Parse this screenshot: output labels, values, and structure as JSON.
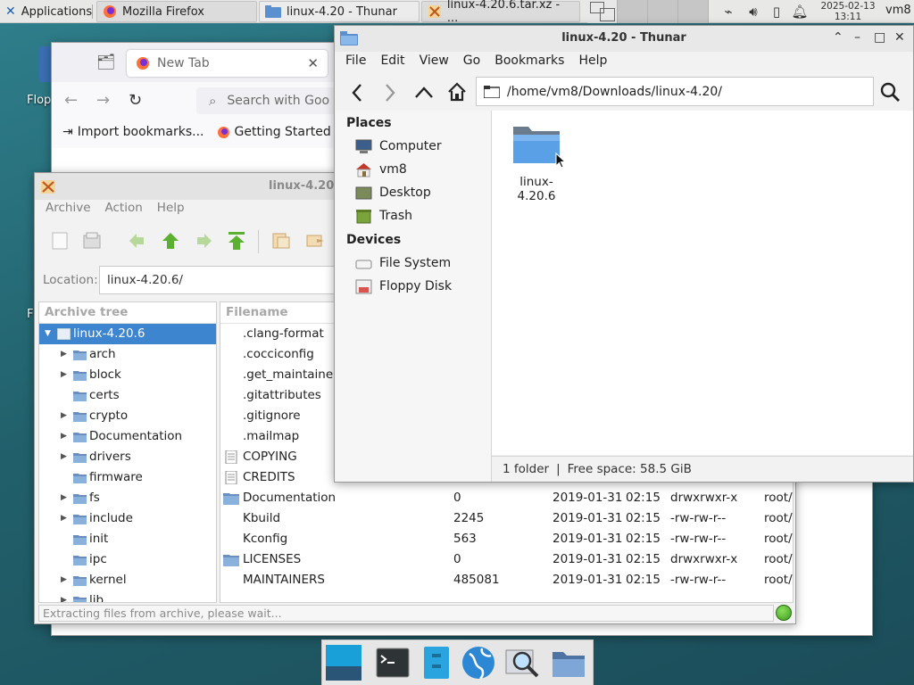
{
  "panel": {
    "applications_label": "Applications",
    "tasks": [
      {
        "label": "Mozilla Firefox"
      },
      {
        "label": "linux-4.20 - Thunar"
      },
      {
        "label": "linux-4.20.6.tar.xz - ..."
      }
    ],
    "clock_date": "2025-02-13",
    "clock_time": "13:11",
    "user": "vm8"
  },
  "desktop": {
    "icon_label_1": "Flop",
    "icon_label_2": "F"
  },
  "firefox": {
    "tab_title": "New Tab",
    "search_placeholder": "Search with Goo",
    "bookmarks": [
      {
        "label": "Import bookmarks..."
      },
      {
        "label": "Getting Started"
      }
    ]
  },
  "xarchiver": {
    "title": "linux-4.20.",
    "menu": [
      "Archive",
      "Action",
      "Help"
    ],
    "location_label": "Location:",
    "location_value": "linux-4.20.6/",
    "tree_header": "Archive tree",
    "tree": [
      {
        "label": "linux-4.20.6",
        "expandable": true,
        "expanded": true,
        "selected": true
      },
      {
        "label": "arch",
        "expandable": true
      },
      {
        "label": "block",
        "expandable": true
      },
      {
        "label": "certs",
        "expandable": false
      },
      {
        "label": "crypto",
        "expandable": true
      },
      {
        "label": "Documentation",
        "expandable": true
      },
      {
        "label": "drivers",
        "expandable": true
      },
      {
        "label": "firmware",
        "expandable": false
      },
      {
        "label": "fs",
        "expandable": true
      },
      {
        "label": "include",
        "expandable": true
      },
      {
        "label": "init",
        "expandable": false
      },
      {
        "label": "ipc",
        "expandable": false
      },
      {
        "label": "kernel",
        "expandable": true
      },
      {
        "label": "lib",
        "expandable": true
      }
    ],
    "file_header": "Filename",
    "files": [
      {
        "name": ".clang-format",
        "kind": "file",
        "size": "",
        "date": "",
        "time": "",
        "perms": "",
        "owner": ""
      },
      {
        "name": ".cocciconfig",
        "kind": "file",
        "size": "",
        "date": "",
        "time": "",
        "perms": "",
        "owner": ""
      },
      {
        "name": ".get_maintainer",
        "kind": "file",
        "size": "",
        "date": "",
        "time": "",
        "perms": "",
        "owner": ""
      },
      {
        "name": ".gitattributes",
        "kind": "file",
        "size": "",
        "date": "",
        "time": "",
        "perms": "",
        "owner": ""
      },
      {
        "name": ".gitignore",
        "kind": "file",
        "size": "",
        "date": "",
        "time": "",
        "perms": "",
        "owner": ""
      },
      {
        "name": ".mailmap",
        "kind": "file",
        "size": "",
        "date": "",
        "time": "",
        "perms": "",
        "owner": ""
      },
      {
        "name": "COPYING",
        "kind": "doc",
        "size": "",
        "date": "",
        "time": "",
        "perms": "",
        "owner": ""
      },
      {
        "name": "CREDITS",
        "kind": "doc",
        "size": "",
        "date": "",
        "time": "",
        "perms": "",
        "owner": ""
      },
      {
        "name": "Documentation",
        "kind": "folder",
        "size": "0",
        "date": "2019-01-31",
        "time": "02:15",
        "perms": "drwxrwxr-x",
        "owner": "root/r"
      },
      {
        "name": "Kbuild",
        "kind": "file",
        "size": "2245",
        "date": "2019-01-31",
        "time": "02:15",
        "perms": "-rw-rw-r--",
        "owner": "root/r"
      },
      {
        "name": "Kconfig",
        "kind": "file",
        "size": "563",
        "date": "2019-01-31",
        "time": "02:15",
        "perms": "-rw-rw-r--",
        "owner": "root/r"
      },
      {
        "name": "LICENSES",
        "kind": "folder",
        "size": "0",
        "date": "2019-01-31",
        "time": "02:15",
        "perms": "drwxrwxr-x",
        "owner": "root/r"
      },
      {
        "name": "MAINTAINERS",
        "kind": "file",
        "size": "485081",
        "date": "2019-01-31",
        "time": "02:15",
        "perms": "-rw-rw-r--",
        "owner": "root/r"
      }
    ],
    "status_text": "Extracting files from archive, please wait..."
  },
  "thunar": {
    "title": "linux-4.20 - Thunar",
    "menu": [
      "File",
      "Edit",
      "View",
      "Go",
      "Bookmarks",
      "Help"
    ],
    "path": "/home/vm8/Downloads/linux-4.20/",
    "places_header": "Places",
    "places": [
      {
        "label": "Computer",
        "icon": "computer-icon"
      },
      {
        "label": "vm8",
        "icon": "home-icon"
      },
      {
        "label": "Desktop",
        "icon": "desktop-icon"
      },
      {
        "label": "Trash",
        "icon": "trash-icon"
      }
    ],
    "devices_header": "Devices",
    "devices": [
      {
        "label": "File System",
        "icon": "drive-icon"
      },
      {
        "label": "Floppy Disk",
        "icon": "floppy-icon"
      }
    ],
    "items": [
      {
        "label": "linux-4.20.6",
        "icon": "folder-icon"
      }
    ],
    "status_count": "1 folder",
    "status_sep": "|",
    "status_free": "Free space: 58.5 GiB"
  },
  "colors": {
    "selection": "#3d86cf",
    "folder": "#5aa0e6",
    "status_ok": "#4caf28"
  }
}
